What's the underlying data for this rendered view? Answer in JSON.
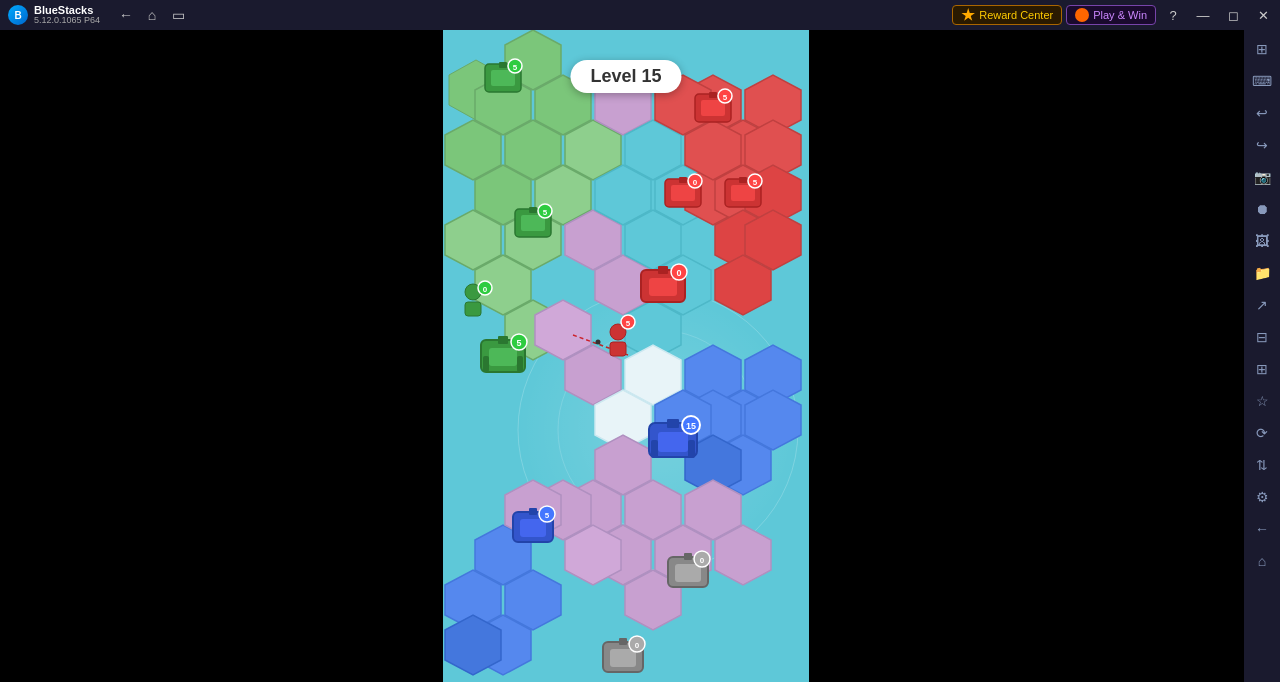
{
  "titlebar": {
    "app_name": "BlueStacks",
    "app_version": "5.12.0.1065  P64",
    "reward_center_label": "Reward Center",
    "play_win_label": "Play & Win"
  },
  "game": {
    "level_label": "Level 15"
  },
  "sidebar": {
    "icons": [
      "⊕",
      "🏠",
      "⊞",
      "❓",
      "—",
      "⊡",
      "✕"
    ]
  }
}
